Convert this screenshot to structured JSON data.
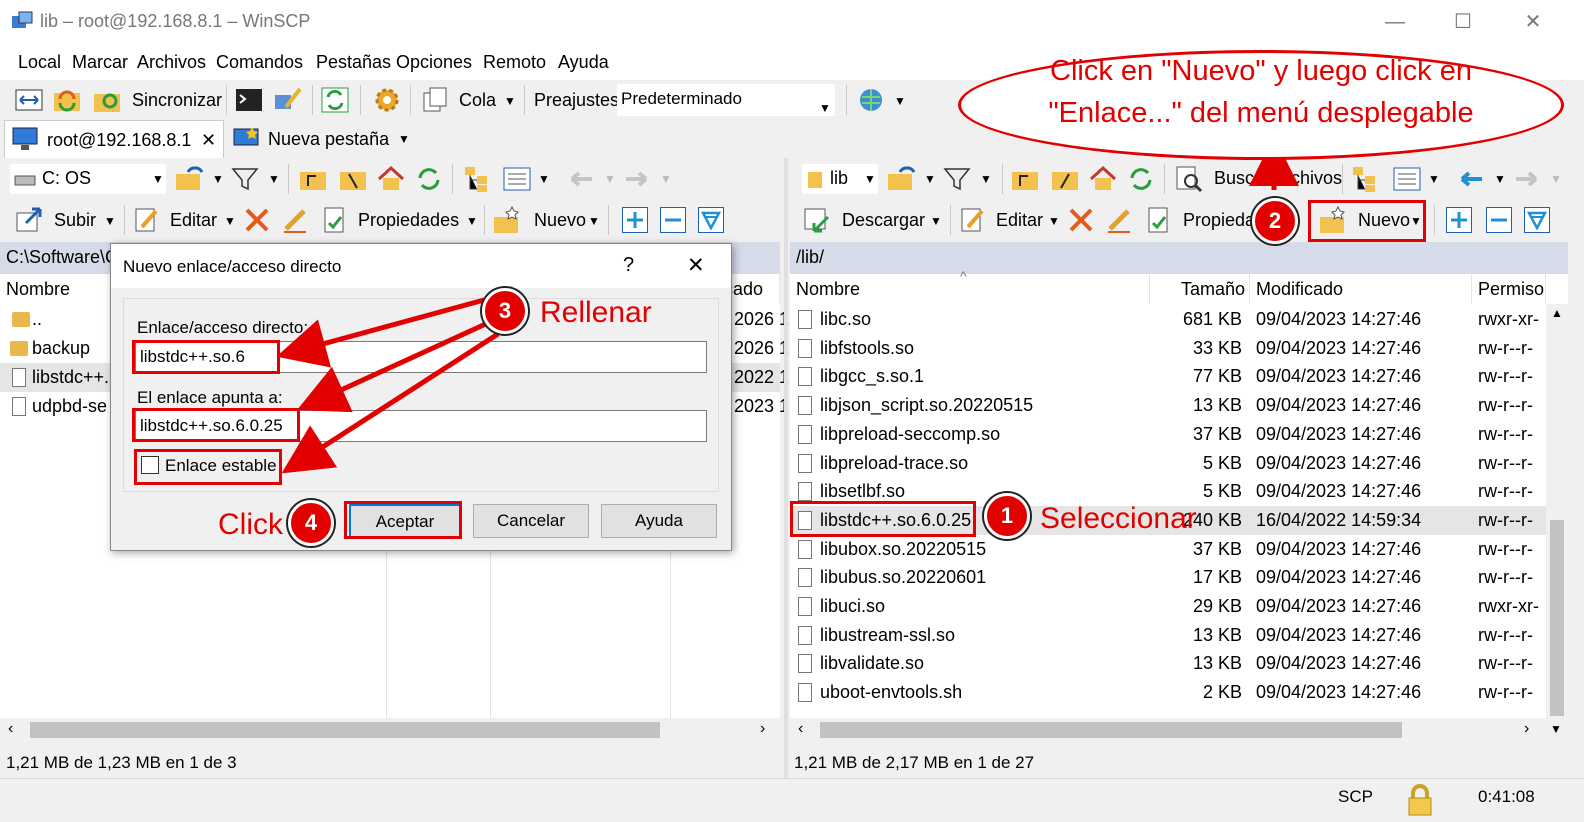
{
  "window": {
    "title": "lib – root@192.168.8.1 – WinSCP",
    "minimize": "—",
    "maximize": "☐",
    "close": "✕"
  },
  "menu": [
    "Local",
    "Marcar",
    "Archivos",
    "Comandos",
    "Pestañas",
    "Opciones",
    "Remoto",
    "Ayuda"
  ],
  "toolbar": {
    "sync_label": "Sincronizar",
    "queue_label": "Cola",
    "presets_label": "Preajustes",
    "presets_value": "Predeterminado"
  },
  "tabs": {
    "session": "root@192.168.8.1",
    "close": "✕",
    "new_tab": "Nueva pestaña"
  },
  "left": {
    "drive": "C: OS",
    "upload": "Subir",
    "edit": "Editar",
    "properties": "Propiedades",
    "new": "Nuevo",
    "path": "C:\\Software\\C",
    "col_name": "Nombre",
    "col_mod": "cado",
    "rows": [
      {
        "name": "..",
        "date": "2026 1"
      },
      {
        "name": "backup",
        "date": "2026 1"
      },
      {
        "name": "libstdc++.",
        "date": "2022 1"
      },
      {
        "name": "udpbd-se",
        "date": "2023 1"
      }
    ],
    "status": "1,21 MB de 1,23 MB en 1 de 3"
  },
  "right": {
    "folder": "lib",
    "find": "Buscar archivos",
    "download": "Descargar",
    "edit": "Editar",
    "properties": "Propieda",
    "new": "Nuevo",
    "path": "/lib/",
    "columns": {
      "name": "Nombre",
      "size": "Tamaño",
      "modified": "Modificado",
      "perm": "Permiso"
    },
    "rows": [
      {
        "name": "libc.so",
        "size": "681 KB",
        "modified": "09/04/2023 14:27:46",
        "perm": "rwxr-xr-"
      },
      {
        "name": "libfstools.so",
        "size": "33 KB",
        "modified": "09/04/2023 14:27:46",
        "perm": "rw-r--r-"
      },
      {
        "name": "libgcc_s.so.1",
        "size": "77 KB",
        "modified": "09/04/2023 14:27:46",
        "perm": "rw-r--r-"
      },
      {
        "name": "libjson_script.so.20220515",
        "size": "13 KB",
        "modified": "09/04/2023 14:27:46",
        "perm": "rw-r--r-"
      },
      {
        "name": "libpreload-seccomp.so",
        "size": "37 KB",
        "modified": "09/04/2023 14:27:46",
        "perm": "rw-r--r-"
      },
      {
        "name": "libpreload-trace.so",
        "size": "5 KB",
        "modified": "09/04/2023 14:27:46",
        "perm": "rw-r--r-"
      },
      {
        "name": "libsetlbf.so",
        "size": "5 KB",
        "modified": "09/04/2023 14:27:46",
        "perm": "rw-r--r-"
      },
      {
        "name": "libstdc++.so.6.0.25",
        "size": "240 KB",
        "modified": "16/04/2022 14:59:34",
        "perm": "rw-r--r-"
      },
      {
        "name": "libubox.so.20220515",
        "size": "37 KB",
        "modified": "09/04/2023 14:27:46",
        "perm": "rw-r--r-"
      },
      {
        "name": "libubus.so.20220601",
        "size": "17 KB",
        "modified": "09/04/2023 14:27:46",
        "perm": "rw-r--r-"
      },
      {
        "name": "libuci.so",
        "size": "29 KB",
        "modified": "09/04/2023 14:27:46",
        "perm": "rwxr-xr-"
      },
      {
        "name": "libustream-ssl.so",
        "size": "13 KB",
        "modified": "09/04/2023 14:27:46",
        "perm": "rw-r--r-"
      },
      {
        "name": "libvalidate.so",
        "size": "13 KB",
        "modified": "09/04/2023 14:27:46",
        "perm": "rw-r--r-"
      },
      {
        "name": "uboot-envtools.sh",
        "size": "2 KB",
        "modified": "09/04/2023 14:27:46",
        "perm": "rw-r--r-"
      }
    ],
    "status": "1,21 MB de 2,17 MB en 1 de 27"
  },
  "bottom": {
    "protocol": "SCP",
    "time": "0:41:08"
  },
  "dialog": {
    "title": "Nuevo enlace/acceso directto",
    "help_q": "?",
    "close": "✕",
    "link_label": "Enlace/acceso directo:",
    "link_value": "libstdc++.so.6",
    "target_label": "El enlace apunta a:",
    "target_value": "libstdc++.so.6.0.25",
    "hard_link": "Enlace estable",
    "ok": "Aceptar",
    "cancel": "Cancelar",
    "help": "Ayuda"
  },
  "annotations": {
    "callout_line1": "Click en \"Nuevo\" y luego click en",
    "callout_line2": "\"Enlace...\" del menú desplegable",
    "step1": "1",
    "step1_text": "Seleccionar",
    "step2": "2",
    "step3": "3",
    "step3_text": "Rellenar",
    "step4": "4",
    "step4_text": "Click",
    "accent": "#e30000"
  }
}
